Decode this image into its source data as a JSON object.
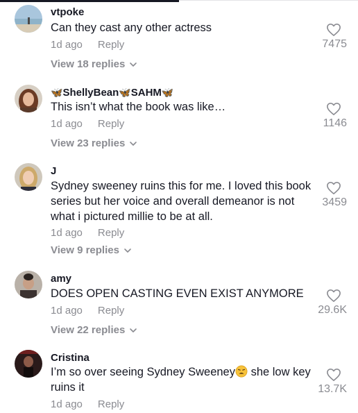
{
  "comments": [
    {
      "username": "vtpoke",
      "text": "Can they cast any other actress",
      "time": "1d ago",
      "reply_label": "Reply",
      "replies_label": "View 18 replies",
      "likes": "7475"
    },
    {
      "username_parts": [
        "ShellyBean",
        "SAHM"
      ],
      "username_icon": "butterfly-emoji",
      "text": "This isn’t what the book was like…",
      "time": "1d ago",
      "reply_label": "Reply",
      "replies_label": "View 23 replies",
      "likes": "1146"
    },
    {
      "username": "J",
      "text": "Sydney sweeney ruins this for me. I loved this book series but her voice and overall demeanor is not what i pictured millie to be at all.",
      "time": "1d ago",
      "reply_label": "Reply",
      "replies_label": "View 9 replies",
      "likes": "3459"
    },
    {
      "username": "amy",
      "text": "DOES OPEN CASTING EVEN EXIST ANYMORE",
      "time": "1d ago",
      "reply_label": "Reply",
      "replies_label": "View 22 replies",
      "likes": "29.6K"
    },
    {
      "username": "Cristina",
      "text_before": "I’m so over seeing Sydney Sweeney",
      "text_emoji": "tired-face-emoji",
      "text_after": " she low key ruins it",
      "time": "1d ago",
      "reply_label": "Reply",
      "likes": "13.7K"
    }
  ],
  "colors": {
    "primary_text": "#161823",
    "secondary_text": "#8a8b91",
    "heart_outline": "#8a8b91"
  }
}
